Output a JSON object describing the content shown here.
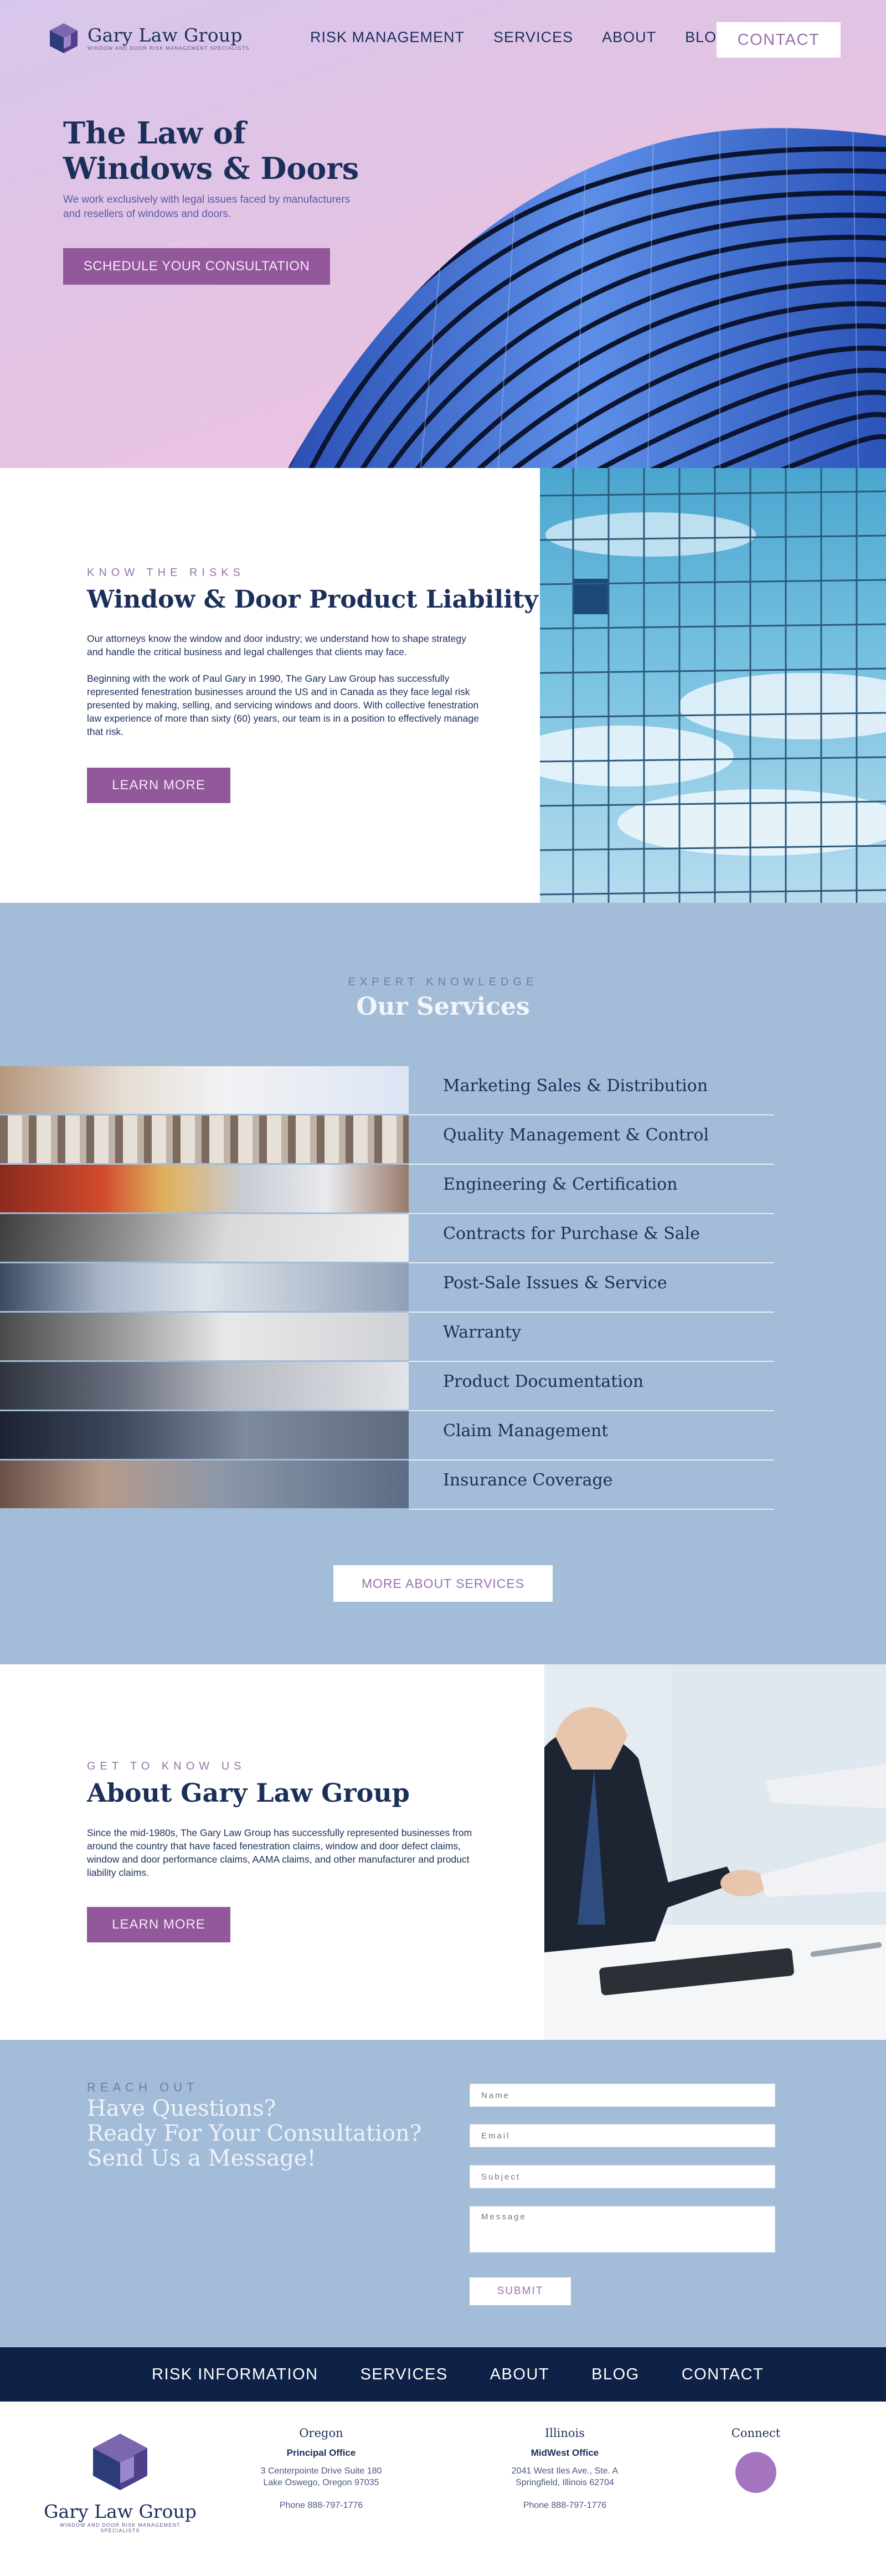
{
  "brand": {
    "name": "Gary Law Group",
    "tagline": "Window and Door Risk Management Specialists"
  },
  "nav": {
    "links": [
      "RISK MANAGEMENT",
      "SERVICES",
      "ABOUT",
      "BLOG"
    ],
    "contact": "CONTACT"
  },
  "hero": {
    "title_line1": "The Law of",
    "title_line2": "Windows & Doors",
    "subtitle": "We work exclusively with legal issues faced by manufacturers and resellers of windows and doors.",
    "cta": "SCHEDULE YOUR CONSULTATION"
  },
  "risks": {
    "eyebrow": "KNOW THE RISKS",
    "title": "Window & Door Product Liability",
    "p1": "Our attorneys know the window and door industry; we understand how to shape strategy and handle the critical business and legal challenges that clients may face.",
    "p2": "Beginning with the work of Paul Gary in 1990, The Gary Law Group has successfully represented fenestration businesses around the US and in Canada as they face legal risk presented by making, selling, and servicing windows and doors.  With collective fenestration law experience of more than sixty (60) years, our team is in a position to effectively manage that risk.",
    "cta": "LEARN MORE"
  },
  "services": {
    "eyebrow": "EXPERT KNOWLEDGE",
    "title": "Our Services",
    "items": [
      "Marketing Sales & Distribution",
      "Quality Management & Control",
      "Engineering & Certification",
      "Contracts for Purchase & Sale",
      "Post-Sale Issues & Service",
      "Warranty",
      "Product Documentation",
      "Claim Management",
      "Insurance Coverage"
    ],
    "more": "MORE ABOUT SERVICES"
  },
  "about": {
    "eyebrow": "GET TO KNOW US",
    "title": "About Gary Law Group",
    "body": "Since the mid-1980s, The Gary Law Group has successfully represented businesses from around the country that have faced fenestration claims, window and door defect claims, window and door performance claims, AAMA claims, and other manufacturer and product liability claims.",
    "cta": "LEARN MORE"
  },
  "reach": {
    "eyebrow": "REACH OUT",
    "line1": "Have Questions?",
    "line2": "Ready For Your Consultation?",
    "line3": "Send Us a Message!",
    "fields": {
      "name": "Name",
      "email": "Email",
      "subject": "Subject",
      "message": "Message"
    },
    "submit": "SUBMIT"
  },
  "footer_nav": [
    "RISK INFORMATION",
    "SERVICES",
    "ABOUT",
    "BLOG",
    "CONTACT"
  ],
  "footer": {
    "oregon": {
      "state": "Oregon",
      "office": "Principal Office",
      "addr1": "3 Centerpointe Drive Suite 180",
      "addr2": "Lake Oswego, Oregon 97035",
      "phone": "Phone 888-797-1776"
    },
    "illinois": {
      "state": "Illinois",
      "office": "MidWest Office",
      "addr1": "2041 West Iles Ave., Ste. A",
      "addr2": "Springfield, Illinois 62704",
      "phone": "Phone 888-797-1776"
    },
    "connect": "Connect"
  },
  "colors": {
    "navy": "#1c2f5a",
    "purple": "#93579c",
    "steel_blue": "#a3bcd8",
    "footer_navy": "#0e2147"
  }
}
